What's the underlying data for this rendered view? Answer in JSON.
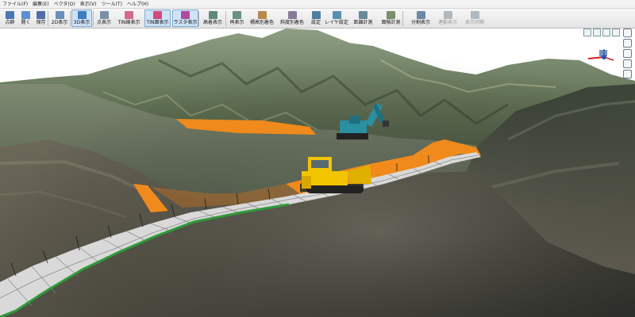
{
  "menu": [
    "ファイル(F)",
    "編集(E)",
    "ベクタ(O)",
    "表示(V)",
    "ツール(T)",
    "ヘルプ(H)"
  ],
  "toolbar": [
    {
      "id": "point-group",
      "label": "点群",
      "icon": "point-cloud-icon",
      "color": "#4a78b6",
      "active": false,
      "disabled": false
    },
    {
      "id": "open",
      "label": "開く",
      "icon": "open-file-icon",
      "color": "#5c8fd0",
      "active": false,
      "disabled": false
    },
    {
      "id": "save",
      "label": "保存",
      "icon": "save-icon",
      "color": "#4f6fa8",
      "active": false,
      "disabled": false
    },
    {
      "id": "view-2d",
      "label": "2D表示",
      "icon": "view-2d-icon",
      "color": "#6a8fb8",
      "active": false,
      "disabled": false
    },
    {
      "id": "view-3d",
      "label": "3D表示",
      "icon": "view-3d-icon",
      "color": "#3d7cc0",
      "active": true,
      "disabled": false
    },
    {
      "id": "point-display",
      "label": "点表示",
      "icon": "point-display-icon",
      "color": "#7a8fa6",
      "active": false,
      "disabled": false
    },
    {
      "id": "tin-line",
      "label": "TIN線表示",
      "icon": "tin-line-icon",
      "color": "#d26a8a",
      "active": false,
      "disabled": false
    },
    {
      "id": "tin-surface",
      "label": "TIN面表示",
      "icon": "tin-surface-icon",
      "color": "#d04b7a",
      "active": true,
      "disabled": false
    },
    {
      "id": "raster",
      "label": "ラスタ表示",
      "icon": "raster-icon",
      "color": "#b04aa0",
      "active": true,
      "disabled": false
    },
    {
      "id": "elevation",
      "label": "高着表示",
      "icon": "elevation-icon",
      "color": "#5f8a7a",
      "active": false,
      "disabled": false
    },
    {
      "id": "redisplay",
      "label": "再表示",
      "icon": "redisplay-icon",
      "color": "#6d8f82",
      "active": false,
      "disabled": false
    },
    {
      "id": "height-color",
      "label": "標高別着色",
      "icon": "height-color-icon",
      "color": "#b9884d",
      "active": false,
      "disabled": false
    },
    {
      "id": "slope-color",
      "label": "斜度別着色",
      "icon": "slope-color-icon",
      "color": "#8a7a9a",
      "active": false,
      "disabled": false
    },
    {
      "id": "settings",
      "label": "設定",
      "icon": "settings-icon",
      "color": "#4f7fa0",
      "active": false,
      "disabled": false
    },
    {
      "id": "layer-settings",
      "label": "レイヤ設定",
      "icon": "layer-settings-icon",
      "color": "#5a8fb0",
      "active": false,
      "disabled": false
    },
    {
      "id": "distance",
      "label": "距離計測",
      "icon": "distance-icon",
      "color": "#6a8a9a",
      "active": false,
      "disabled": false
    },
    {
      "id": "area",
      "label": "面積計測",
      "icon": "area-icon",
      "color": "#7a8f6a",
      "active": false,
      "disabled": false
    },
    {
      "id": "split-view",
      "label": "分割表示",
      "icon": "split-view-icon",
      "color": "#6a88a8",
      "active": false,
      "disabled": false
    },
    {
      "id": "linked-view",
      "label": "連動表示",
      "icon": "linked-view-icon",
      "color": "#b0b8c0",
      "active": false,
      "disabled": true
    },
    {
      "id": "display-sync",
      "label": "表示同期",
      "icon": "display-sync-icon",
      "color": "#b0b8c0",
      "active": false,
      "disabled": true
    }
  ],
  "colors": {
    "sky": "#ffffff",
    "terrain_dark": "#3d4a3a",
    "terrain_mid": "#6a7a5a",
    "terrain_light": "#a8b59a",
    "fill_orange": "#f08a1c",
    "road_gray": "#d9d9d9",
    "edge_green": "#2f9a3a",
    "bulldozer_yellow": "#f2c500",
    "excavator_teal": "#2a8fa0"
  }
}
